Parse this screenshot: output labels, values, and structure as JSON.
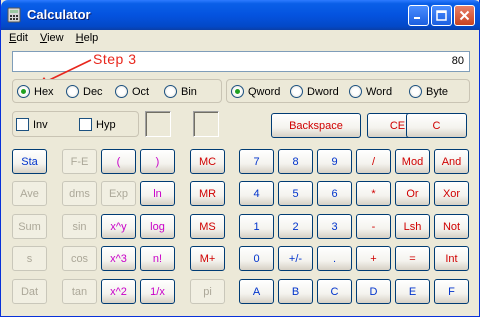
{
  "window": {
    "title": "Calculator",
    "colors": {
      "titlebar": "#0453DF",
      "face": "#ECE9D8",
      "annotation": "#E8261C"
    }
  },
  "menu": [
    {
      "underline": "E",
      "rest": "dit"
    },
    {
      "underline": "V",
      "rest": "iew"
    },
    {
      "underline": "H",
      "rest": "elp"
    }
  ],
  "display": {
    "value": "80"
  },
  "annotation": {
    "text": "Step 3"
  },
  "base_radios": [
    {
      "label": "Hex",
      "selected": true
    },
    {
      "label": "Dec",
      "selected": false
    },
    {
      "label": "Oct",
      "selected": false
    },
    {
      "label": "Bin",
      "selected": false
    }
  ],
  "word_radios": [
    {
      "label": "Qword",
      "selected": true
    },
    {
      "label": "Dword",
      "selected": false
    },
    {
      "label": "Word",
      "selected": false
    },
    {
      "label": "Byte",
      "selected": false
    }
  ],
  "checks": [
    {
      "label": "Inv",
      "checked": false
    },
    {
      "label": "Hyp",
      "checked": false
    }
  ],
  "edit_buttons": [
    "Backspace",
    "CE",
    "C"
  ],
  "stat_buttons": [
    {
      "label": "Sta",
      "enabled": true
    },
    {
      "label": "Ave",
      "enabled": false
    },
    {
      "label": "Sum",
      "enabled": false
    },
    {
      "label": "s",
      "enabled": false
    },
    {
      "label": "Dat",
      "enabled": false
    }
  ],
  "sci_col1": [
    {
      "label": "F-E",
      "enabled": false
    },
    {
      "label": "dms",
      "enabled": false
    },
    {
      "label": "sin",
      "enabled": false
    },
    {
      "label": "cos",
      "enabled": false
    },
    {
      "label": "tan",
      "enabled": false
    }
  ],
  "sci_col2": [
    {
      "label": "(",
      "enabled": true
    },
    {
      "label": "Exp",
      "enabled": false
    },
    {
      "label": "x^y",
      "enabled": true
    },
    {
      "label": "x^3",
      "enabled": true
    },
    {
      "label": "x^2",
      "enabled": true
    }
  ],
  "sci_col3": [
    {
      "label": ")",
      "enabled": true
    },
    {
      "label": "ln",
      "enabled": true
    },
    {
      "label": "log",
      "enabled": true
    },
    {
      "label": "n!",
      "enabled": true
    },
    {
      "label": "1/x",
      "enabled": true
    }
  ],
  "memory_buttons": [
    {
      "label": "MC",
      "enabled": true
    },
    {
      "label": "MR",
      "enabled": true
    },
    {
      "label": "MS",
      "enabled": true
    },
    {
      "label": "M+",
      "enabled": true
    },
    {
      "label": "pi",
      "enabled": false
    }
  ],
  "keypad": [
    [
      "7",
      "8",
      "9",
      "/",
      "Mod",
      "And"
    ],
    [
      "4",
      "5",
      "6",
      "*",
      "Or",
      "Xor"
    ],
    [
      "1",
      "2",
      "3",
      "-",
      "Lsh",
      "Not"
    ],
    [
      "0",
      "+/-",
      ".",
      "+",
      "=",
      "Int"
    ],
    [
      "A",
      "B",
      "C",
      "D",
      "E",
      "F"
    ]
  ]
}
